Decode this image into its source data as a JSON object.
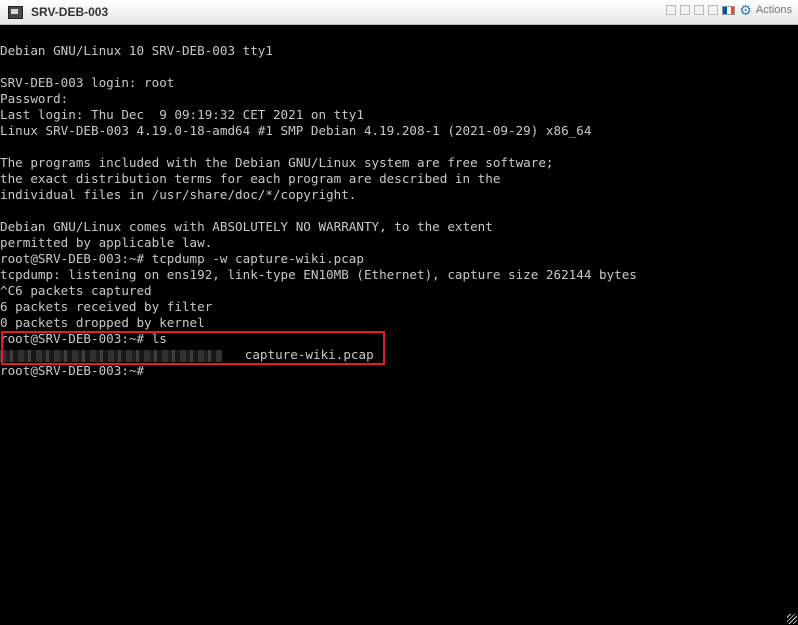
{
  "window": {
    "title": "SRV-DEB-003",
    "actions_label": "Actions"
  },
  "colors": {
    "flag_blue": "#0055a4",
    "flag_white": "#ffffff",
    "flag_red": "#ef4135",
    "highlight_border": "#e02020"
  },
  "terminal": {
    "lines": [
      "Debian GNU/Linux 10 SRV-DEB-003 tty1",
      "",
      "SRV-DEB-003 login: root",
      "Password:",
      "Last login: Thu Dec  9 09:19:32 CET 2021 on tty1",
      "Linux SRV-DEB-003 4.19.0-18-amd64 #1 SMP Debian 4.19.208-1 (2021-09-29) x86_64",
      "",
      "The programs included with the Debian GNU/Linux system are free software;",
      "the exact distribution terms for each program are described in the",
      "individual files in /usr/share/doc/*/copyright.",
      "",
      "Debian GNU/Linux comes with ABSOLUTELY NO WARRANTY, to the extent",
      "permitted by applicable law.",
      "root@SRV-DEB-003:~# tcpdump -w capture-wiki.pcap",
      "tcpdump: listening on ens192, link-type EN10MB (Ethernet), capture size 262144 bytes",
      "^C6 packets captured",
      "6 packets received by filter",
      "0 packets dropped by kernel",
      "root@SRV-DEB-003:~# ls",
      "",
      "root@SRV-DEB-003:~#"
    ],
    "ls_file": "capture-wiki.pcap"
  }
}
